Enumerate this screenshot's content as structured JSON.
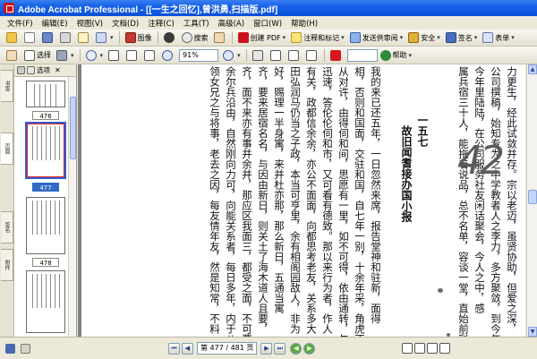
{
  "window": {
    "title": "Adobe Acrobat Professional - [[一生之回忆],曾洪勇,扫描版.pdf]"
  },
  "menu": [
    "文件(F)",
    "编辑(E)",
    "视图(V)",
    "文档(D)",
    "注释(C)",
    "工具(T)",
    "高级(A)",
    "窗口(W)",
    "帮助(H)"
  ],
  "toolbar1": {
    "print_label": "",
    "image_label": "图像",
    "search_label": "搜索",
    "create_pdf_label": "创建 PDF",
    "comment_label": "注释和标记",
    "send_review_label": "发送供审阅",
    "secure_label": "安全",
    "sign_label": "签名",
    "forms_label": "表单"
  },
  "toolbar2": {
    "select_label": "选择",
    "zoom_value": "91%",
    "help_label": "帮助"
  },
  "thumbnails": {
    "header_label": "选项",
    "pages": [
      "476",
      "477",
      "478"
    ],
    "selected": "477"
  },
  "navtabs": [
    "书签",
    "页面",
    "签名",
    "附件"
  ],
  "document": {
    "columns": [
      "力更生，经此试敛并存。宗以老迈，虽贤协助，但爱之深，",
      "公司撰稿，始知专为之中学教者人之李力，多方聚敛，到今年仍",
      "今年里陆陆，在公司服务社友闲话聚会，今人之中，感",
      "属兵宿三十人，能拖着说品，总不名单，容谈一堂，直始前彩",
      "",
      "一五七",
      "故旧闻耆接办国小报",
      "",
      "我的来已还五年，一日忽然来席，报告堂神和驻新，面得",
      "相，否则和国面，交驻和国，自七年一别，十余年采，角虎不尽",
      "从对许，由得伺和间，思愿有一里，如不可得，依由通转，与",
      "迅速，答伦伦伺和市，又可看有德致。那以来行为者，作人",
      "有关，政都信余余，亦公不面面，向都思考老友，关系多大",
      "田弘润马仍当之子政，本当可亨里，余有相阁园敌人，非为",
      "好，赐理一半身寓，来并杜亦那，那么新日，五通当寓",
      "齐，要来居宿名名，与因由新日，则关土了海木道人且要，",
      "齐，面不来亦有事并余并，那应区我面三，都受之面，不可要也",
      "余尔兵沿由，自然刚向力可，向能关系者，每日多年，内于八院创",
      "领女兄之与将事，老去之因，每友情年友，然是知常，不料"
    ],
    "corner_mark": "42"
  },
  "statusbar": {
    "page_field": "第 477 / 481 页"
  }
}
